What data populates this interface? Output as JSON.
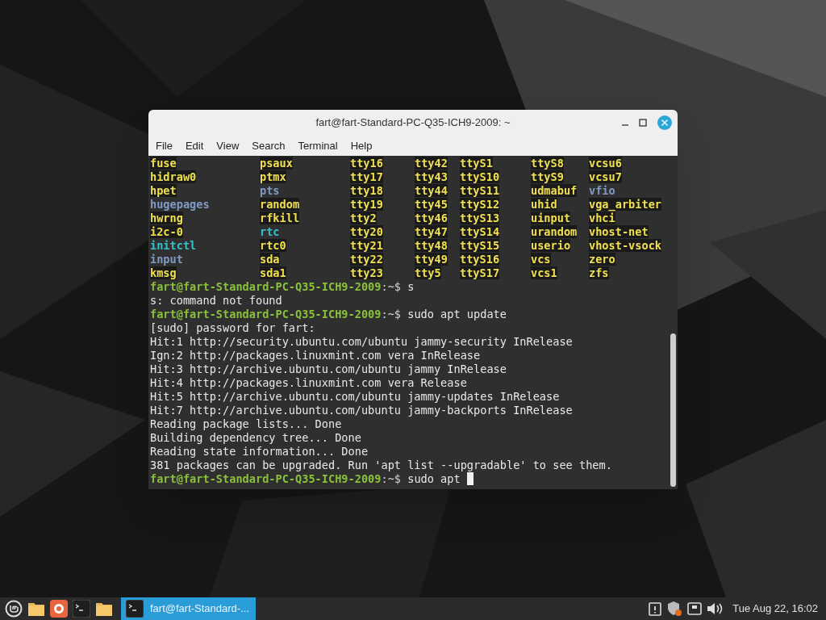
{
  "window": {
    "title": "fart@fart-Standard-PC-Q35-ICH9-2009: ~"
  },
  "menu": [
    "File",
    "Edit",
    "View",
    "Search",
    "Terminal",
    "Help"
  ],
  "listing": [
    [
      {
        "name": "fuse",
        "kind": "device"
      },
      {
        "name": "psaux",
        "kind": "device"
      },
      {
        "name": "tty16",
        "kind": "device"
      },
      {
        "name": "tty42",
        "kind": "device"
      },
      {
        "name": "ttyS1",
        "kind": "device"
      },
      {
        "name": "ttyS8",
        "kind": "device"
      },
      {
        "name": "vcsu6",
        "kind": "device"
      }
    ],
    [
      {
        "name": "hidraw0",
        "kind": "device"
      },
      {
        "name": "ptmx",
        "kind": "device"
      },
      {
        "name": "tty17",
        "kind": "device"
      },
      {
        "name": "tty43",
        "kind": "device"
      },
      {
        "name": "ttyS10",
        "kind": "device"
      },
      {
        "name": "ttyS9",
        "kind": "device"
      },
      {
        "name": "vcsu7",
        "kind": "device"
      }
    ],
    [
      {
        "name": "hpet",
        "kind": "device"
      },
      {
        "name": "pts",
        "kind": "dir"
      },
      {
        "name": "tty18",
        "kind": "device"
      },
      {
        "name": "tty44",
        "kind": "device"
      },
      {
        "name": "ttyS11",
        "kind": "device"
      },
      {
        "name": "udmabuf",
        "kind": "device"
      },
      {
        "name": "vfio",
        "kind": "dir"
      }
    ],
    [
      {
        "name": "hugepages",
        "kind": "dir"
      },
      {
        "name": "random",
        "kind": "device"
      },
      {
        "name": "tty19",
        "kind": "device"
      },
      {
        "name": "tty45",
        "kind": "device"
      },
      {
        "name": "ttyS12",
        "kind": "device"
      },
      {
        "name": "uhid",
        "kind": "device"
      },
      {
        "name": "vga_arbiter",
        "kind": "device"
      }
    ],
    [
      {
        "name": "hwrng",
        "kind": "device"
      },
      {
        "name": "rfkill",
        "kind": "device"
      },
      {
        "name": "tty2",
        "kind": "device"
      },
      {
        "name": "tty46",
        "kind": "device"
      },
      {
        "name": "ttyS13",
        "kind": "device"
      },
      {
        "name": "uinput",
        "kind": "device"
      },
      {
        "name": "vhci",
        "kind": "device"
      }
    ],
    [
      {
        "name": "i2c-0",
        "kind": "device"
      },
      {
        "name": "rtc",
        "kind": "link"
      },
      {
        "name": "tty20",
        "kind": "device"
      },
      {
        "name": "tty47",
        "kind": "device"
      },
      {
        "name": "ttyS14",
        "kind": "device"
      },
      {
        "name": "urandom",
        "kind": "device"
      },
      {
        "name": "vhost-net",
        "kind": "device"
      }
    ],
    [
      {
        "name": "initctl",
        "kind": "link"
      },
      {
        "name": "rtc0",
        "kind": "device"
      },
      {
        "name": "tty21",
        "kind": "device"
      },
      {
        "name": "tty48",
        "kind": "device"
      },
      {
        "name": "ttyS15",
        "kind": "device"
      },
      {
        "name": "userio",
        "kind": "device"
      },
      {
        "name": "vhost-vsock",
        "kind": "device"
      }
    ],
    [
      {
        "name": "input",
        "kind": "dir"
      },
      {
        "name": "sda",
        "kind": "device"
      },
      {
        "name": "tty22",
        "kind": "device"
      },
      {
        "name": "tty49",
        "kind": "device"
      },
      {
        "name": "ttyS16",
        "kind": "device"
      },
      {
        "name": "vcs",
        "kind": "device"
      },
      {
        "name": "zero",
        "kind": "device"
      }
    ],
    [
      {
        "name": "kmsg",
        "kind": "device"
      },
      {
        "name": "sda1",
        "kind": "device"
      },
      {
        "name": "tty23",
        "kind": "device"
      },
      {
        "name": "tty5",
        "kind": "device"
      },
      {
        "name": "ttyS17",
        "kind": "device"
      },
      {
        "name": "vcs1",
        "kind": "device"
      },
      {
        "name": "zfs",
        "kind": "device"
      }
    ]
  ],
  "lines": [
    {
      "kind": "prompt",
      "user_host": "fart@fart-Standard-PC-Q35-ICH9-2009",
      "path": ":~$",
      "command": "s",
      "cursor": false
    },
    {
      "kind": "output",
      "text": "s: command not found"
    },
    {
      "kind": "prompt",
      "user_host": "fart@fart-Standard-PC-Q35-ICH9-2009",
      "path": ":~$",
      "command": "sudo apt update",
      "cursor": false
    },
    {
      "kind": "output",
      "text": "[sudo] password for fart:"
    },
    {
      "kind": "output",
      "text": "Hit:1 http://security.ubuntu.com/ubuntu jammy-security InRelease"
    },
    {
      "kind": "output",
      "text": "Ign:2 http://packages.linuxmint.com vera InRelease"
    },
    {
      "kind": "output",
      "text": "Hit:3 http://archive.ubuntu.com/ubuntu jammy InRelease"
    },
    {
      "kind": "output",
      "text": "Hit:4 http://packages.linuxmint.com vera Release"
    },
    {
      "kind": "output",
      "text": "Hit:5 http://archive.ubuntu.com/ubuntu jammy-updates InRelease"
    },
    {
      "kind": "output",
      "text": "Hit:7 http://archive.ubuntu.com/ubuntu jammy-backports InRelease"
    },
    {
      "kind": "output",
      "text": "Reading package lists... Done"
    },
    {
      "kind": "output",
      "text": "Building dependency tree... Done"
    },
    {
      "kind": "output",
      "text": "Reading state information... Done"
    },
    {
      "kind": "output",
      "text": "381 packages can be upgraded. Run 'apt list --upgradable' to see them."
    },
    {
      "kind": "prompt",
      "user_host": "fart@fart-Standard-PC-Q35-ICH9-2009",
      "path": ":~$",
      "command": "sudo apt",
      "cursor": true
    }
  ],
  "taskbar": {
    "launchers": [
      {
        "kind": "menu"
      },
      {
        "kind": "folder"
      },
      {
        "kind": "browser"
      },
      {
        "kind": "terminal"
      },
      {
        "kind": "folder"
      }
    ],
    "windows": [
      {
        "title": "fart@fart-Standard-...",
        "selected": true
      }
    ],
    "clock": "Tue Aug 22, 16:02"
  }
}
